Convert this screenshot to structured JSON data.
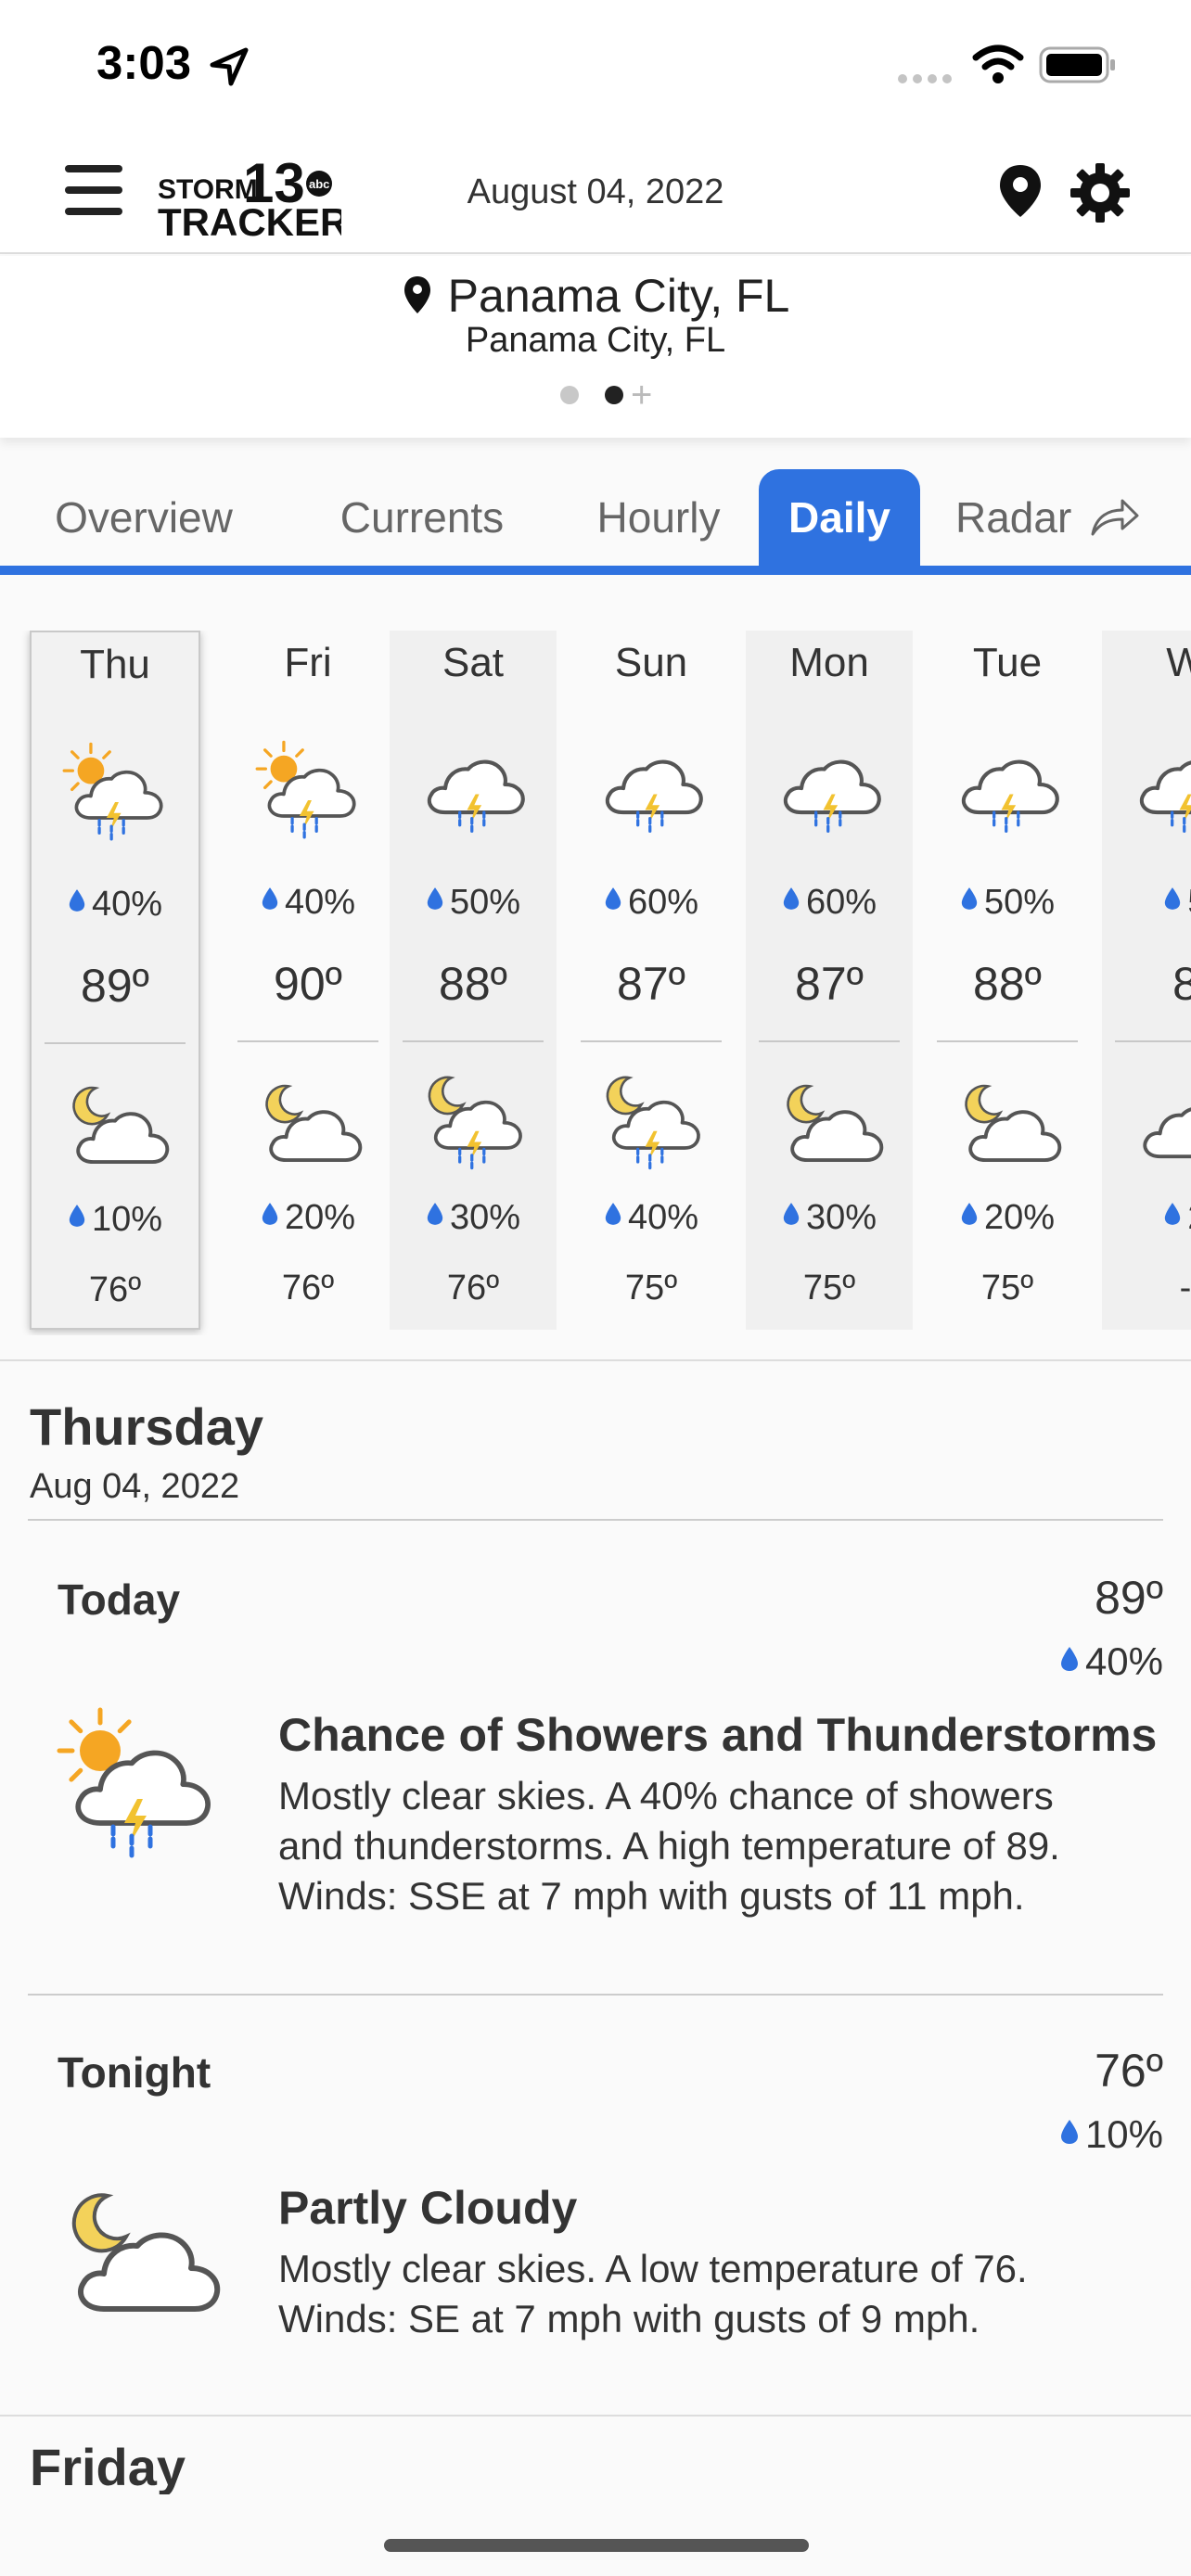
{
  "status_bar": {
    "time": "3:03"
  },
  "header": {
    "menu_icon": "hamburger-menu-icon",
    "logo_text_top": "STORM",
    "logo_number": "13",
    "logo_text_bottom": "TRACKER",
    "logo_badge": "abc",
    "date": "August 04, 2022",
    "pin_icon": "location-pin-icon",
    "settings_icon": "gear-icon"
  },
  "location": {
    "city": "Panama City, FL",
    "subtitle": "Panama City, FL",
    "page_count": 2,
    "active_page": 2
  },
  "tabs": [
    {
      "label": "Overview",
      "active": false
    },
    {
      "label": "Currents",
      "active": false
    },
    {
      "label": "Hourly",
      "active": false
    },
    {
      "label": "Daily",
      "active": true
    },
    {
      "label": "Radar",
      "active": false,
      "icon": "share-arrow-icon"
    }
  ],
  "daily_strip": [
    {
      "day": "Thu",
      "day_icon": "partly-sunny-thunderstorm-icon",
      "day_pop": "40%",
      "high": "89º",
      "night_icon": "partly-cloudy-night-icon",
      "night_pop": "10%",
      "low": "76º",
      "selected": true
    },
    {
      "day": "Fri",
      "day_icon": "partly-sunny-thunderstorm-icon",
      "day_pop": "40%",
      "high": "90º",
      "night_icon": "partly-cloudy-night-icon",
      "night_pop": "20%",
      "low": "76º",
      "selected": false
    },
    {
      "day": "Sat",
      "day_icon": "thunderstorm-icon",
      "day_pop": "50%",
      "high": "88º",
      "night_icon": "night-thunderstorm-icon",
      "night_pop": "30%",
      "low": "76º",
      "selected": false
    },
    {
      "day": "Sun",
      "day_icon": "thunderstorm-icon",
      "day_pop": "60%",
      "high": "87º",
      "night_icon": "night-thunderstorm-icon",
      "night_pop": "40%",
      "low": "75º",
      "selected": false
    },
    {
      "day": "Mon",
      "day_icon": "thunderstorm-icon",
      "day_pop": "60%",
      "high": "87º",
      "night_icon": "partly-cloudy-night-icon",
      "night_pop": "30%",
      "low": "75º",
      "selected": false
    },
    {
      "day": "Tue",
      "day_icon": "thunderstorm-icon",
      "day_pop": "50%",
      "high": "88º",
      "night_icon": "partly-cloudy-night-icon",
      "night_pop": "20%",
      "low": "75º",
      "selected": false
    },
    {
      "day": "W",
      "day_icon": "thunderstorm-icon",
      "day_pop": "5",
      "high": "8",
      "night_icon": "cloud-icon",
      "night_pop": "2",
      "low": "-",
      "selected": false
    }
  ],
  "detail": {
    "day_title": "Thursday",
    "day_date": "Aug 04, 2022",
    "periods": [
      {
        "label": "Today",
        "temp": "89º",
        "pop": "40%",
        "icon": "partly-sunny-thunderstorm-icon",
        "condition": "Chance of Showers and Thunderstorms",
        "description": "Mostly clear skies.  A 40% chance of showers and thunderstorms.  A high temperature of 89.  Winds: SSE at 7 mph with gusts of 11 mph."
      },
      {
        "label": "Tonight",
        "temp": "76º",
        "pop": "10%",
        "icon": "partly-cloudy-night-icon",
        "condition": "Partly Cloudy",
        "description": "Mostly clear skies.  A low temperature of 76.  Winds: SE at 7 mph with gusts of 9 mph."
      }
    ],
    "next_day_title": "Friday"
  },
  "colors": {
    "accent": "#2f72e0",
    "sun": "#f5a623",
    "moon": "#f3d25a",
    "bolt": "#f2c230",
    "rain": "#2f72e0"
  }
}
